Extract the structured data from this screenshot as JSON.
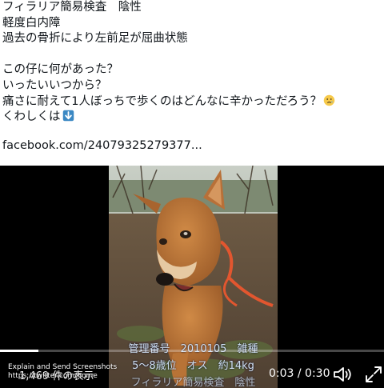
{
  "post": {
    "lines": [
      "フィラリア簡易検査　陰性",
      "軽度白内障",
      "過去の骨折により左前足が屈曲状態",
      "",
      "この仔に何があった？",
      "いったいいつから？",
      "痛さに耐えて1人ぼっちで歩くのはどんなに辛かっただろう？",
      "くわしくは"
    ],
    "crying_emoji_icon": "crying-face-icon",
    "arrow_emoji_icon": "down-arrow-icon",
    "link": "facebook.com/24079325279377..."
  },
  "video": {
    "caption_line1": "管理番号　2010105　雑種",
    "caption_line2": "5～8歳位　オス　約14kg",
    "caption_line3": "フィラリア簡易検査　陰性",
    "progress": 0.1,
    "time": "0:03 / 0:30",
    "tooltip_title": "Explain and Send Screenshots",
    "tooltip_url": "https://twitter.com/home",
    "views": "1,469 件の表示"
  },
  "colors": {
    "text": "#0f1419",
    "caption": "#cfe0f2",
    "player_bg": "#000000"
  }
}
